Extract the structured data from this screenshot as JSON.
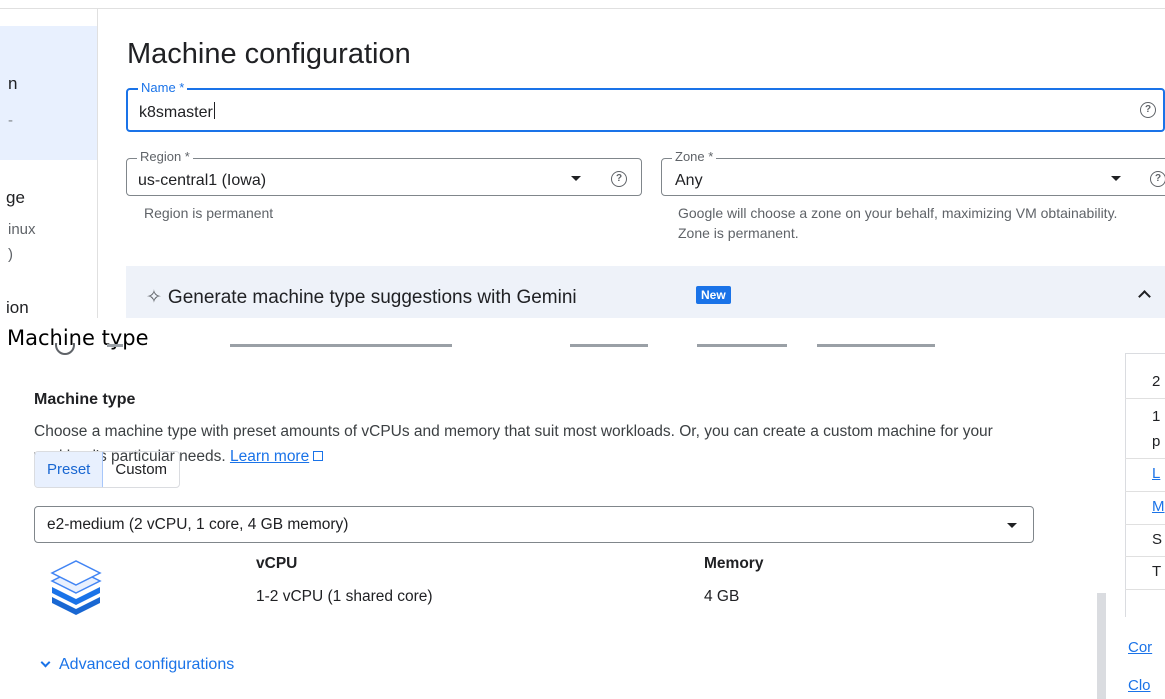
{
  "left_nav": {
    "fragments": [
      "n",
      "-",
      "ge",
      "inux",
      ")",
      "ion"
    ]
  },
  "page_title": "Machine configuration",
  "name_field": {
    "label": "Name *",
    "value": "k8smaster"
  },
  "region_field": {
    "label": "Region *",
    "value": "us-central1 (Iowa)",
    "hint": "Region is permanent"
  },
  "zone_field": {
    "label": "Zone *",
    "value": "Any",
    "hint": "Google will choose a zone on your behalf, maximizing VM obtainability. Zone is permanent."
  },
  "gemini": {
    "text": "Generate machine type suggestions with Gemini",
    "badge": "New"
  },
  "caption": "Machine type",
  "machine_type": {
    "heading": "Machine type",
    "description": "Choose a machine type with preset amounts of vCPUs and memory that suit most workloads. Or, you can create a custom machine for your workload's particular needs.",
    "learn_more": "Learn more",
    "tabs": [
      "Preset",
      "Custom"
    ],
    "selected": "e2-medium (2 vCPU, 1 core, 4 GB memory)",
    "vcpu_label": "vCPU",
    "vcpu_value": "1-2 vCPU (1 shared core)",
    "memory_label": "Memory",
    "memory_value": "4 GB",
    "advanced": "Advanced configurations"
  },
  "right_panel": {
    "items": [
      "2",
      "1",
      "p",
      "L",
      "M",
      "S",
      "T"
    ],
    "links": [
      "Cor",
      "Clo"
    ]
  },
  "colors": {
    "accent": "#1a73e8",
    "selected_bg": "#e8f0fe",
    "gemini_bg": "#eef2f9"
  }
}
